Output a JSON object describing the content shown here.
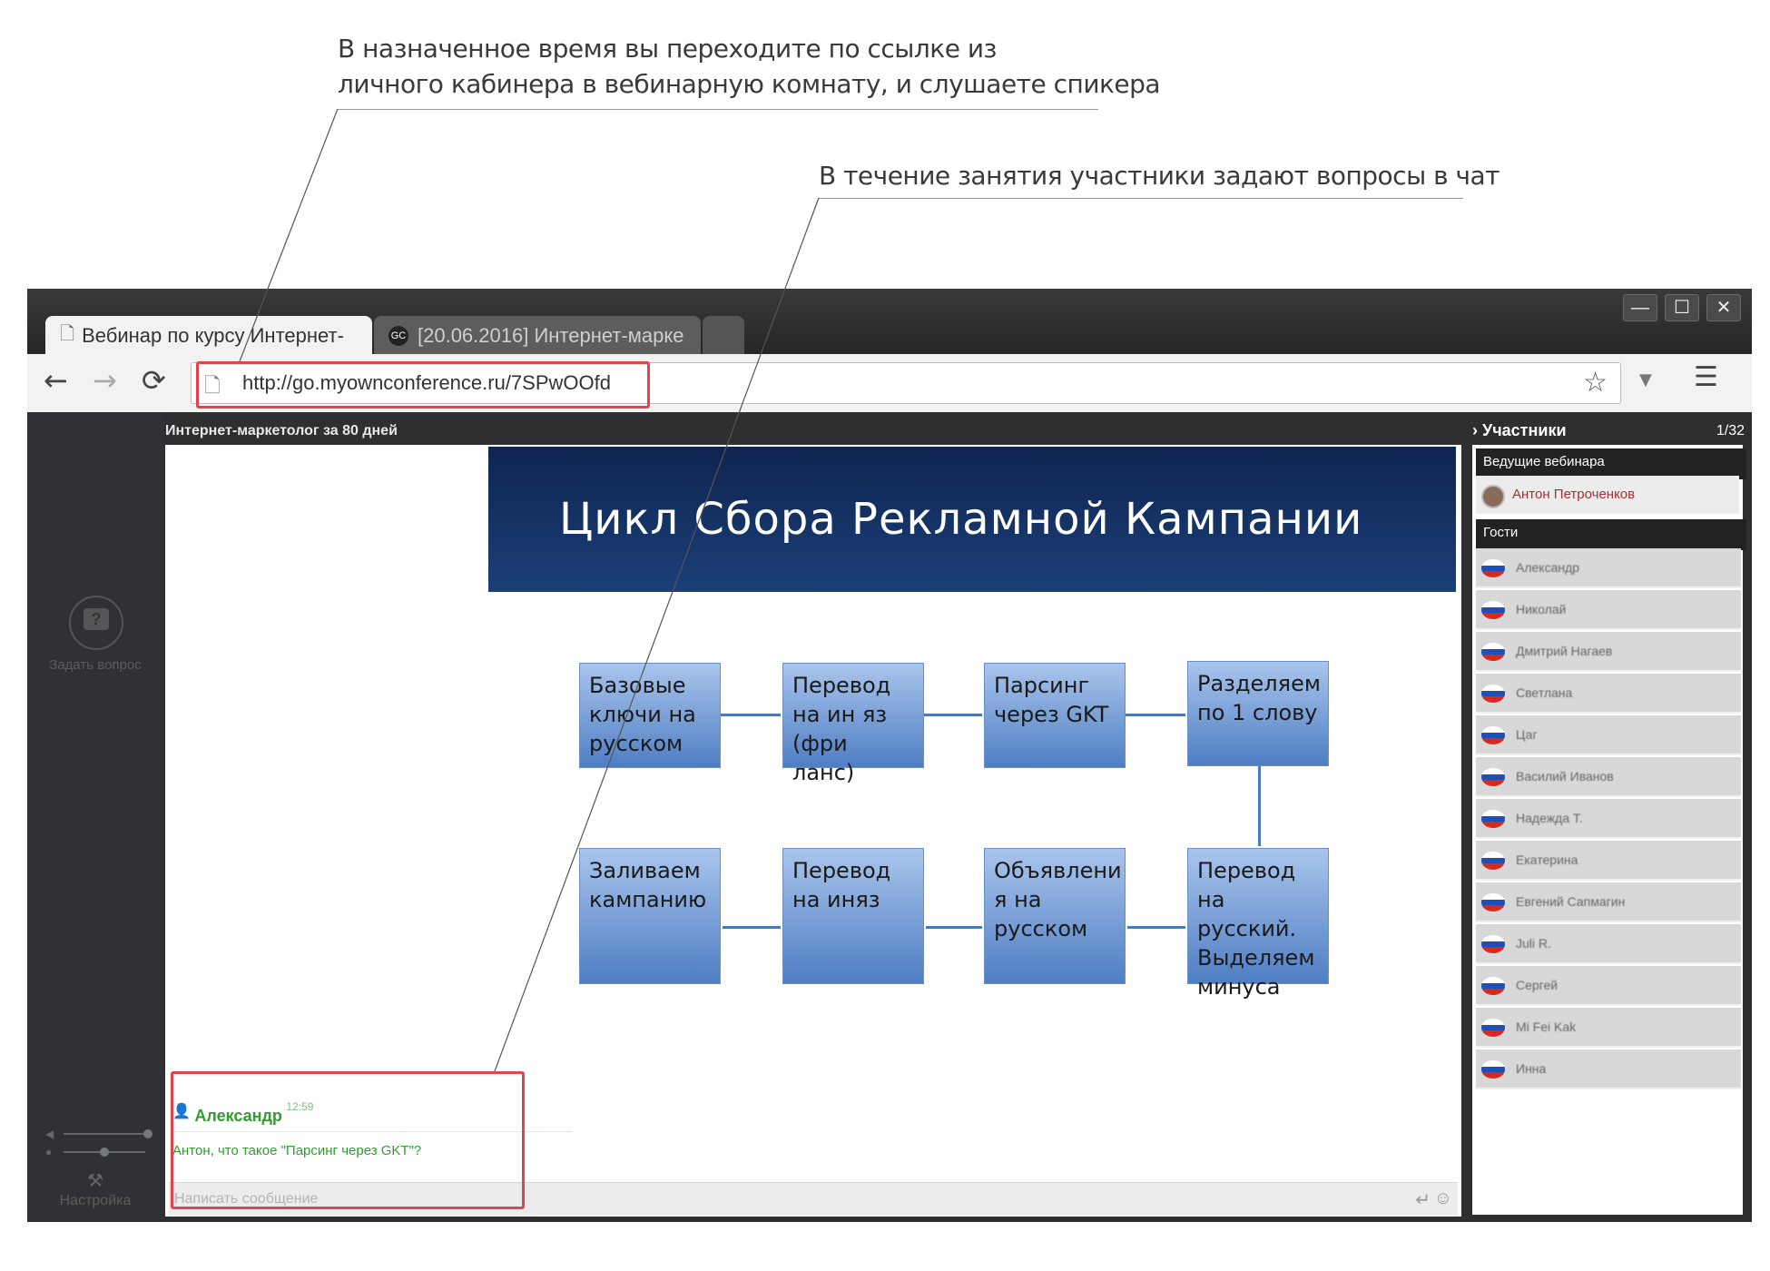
{
  "callouts": {
    "first_line1": "В назначенное время вы переходите по ссылке из",
    "first_line2": "личного кабинера в вебинарную комнату, и слушаете спикера",
    "second": "В течение занятия участники задают вопросы в чат"
  },
  "browser": {
    "tabs": [
      {
        "label": "Вебинар по курсу Интернет-"
      },
      {
        "label": "[20.06.2016] Интернет-марке"
      }
    ],
    "url": "http://go.myownconference.ru/7SPwOOfd",
    "window_controls": {
      "minimize": "—",
      "maximize": "☐",
      "close": "✕"
    }
  },
  "webinar": {
    "course_title": "Интернет-маркетолог за 80 дней",
    "ask_question": "Задать вопрос",
    "settings": "Настройка",
    "slide": {
      "title": "Цикл Сбора Рекламной Кампании",
      "row1": [
        "Базовые ключи на русском",
        "Перевод на ин яз (фри ланс)",
        "Парсинг через GKT",
        "Разделяем по 1 слову"
      ],
      "row2": [
        "Заливаем кампанию",
        "Перевод на иняз",
        "Объявлени я на русском",
        "Перевод на русский. Выделяем минуса"
      ]
    },
    "chat": {
      "author": "Александр",
      "time": "12:59",
      "message": "Антон, что такое \"Парсинг через GKT\"?",
      "input_placeholder": "Написать сообщение"
    },
    "participants": {
      "header": "Участники",
      "count": "1/32",
      "hosts_label": "Ведущие вебинара",
      "host": "Антон Петроченков",
      "guests_label": "Гости",
      "guests": [
        "Александр",
        "Николай",
        "Дмитрий Нагаев",
        "Светлана",
        "Цаг",
        "Василий Иванов",
        "Надежда Т.",
        "Екатерина",
        "Евгений Сапмагин",
        "Juli R.",
        "Сергей",
        "Mi Fei Kak",
        "Инна"
      ]
    }
  },
  "colors": {
    "highlight": "#e0444f",
    "slide_header": "#1b3f78",
    "chat_green": "#2e9e2e"
  }
}
